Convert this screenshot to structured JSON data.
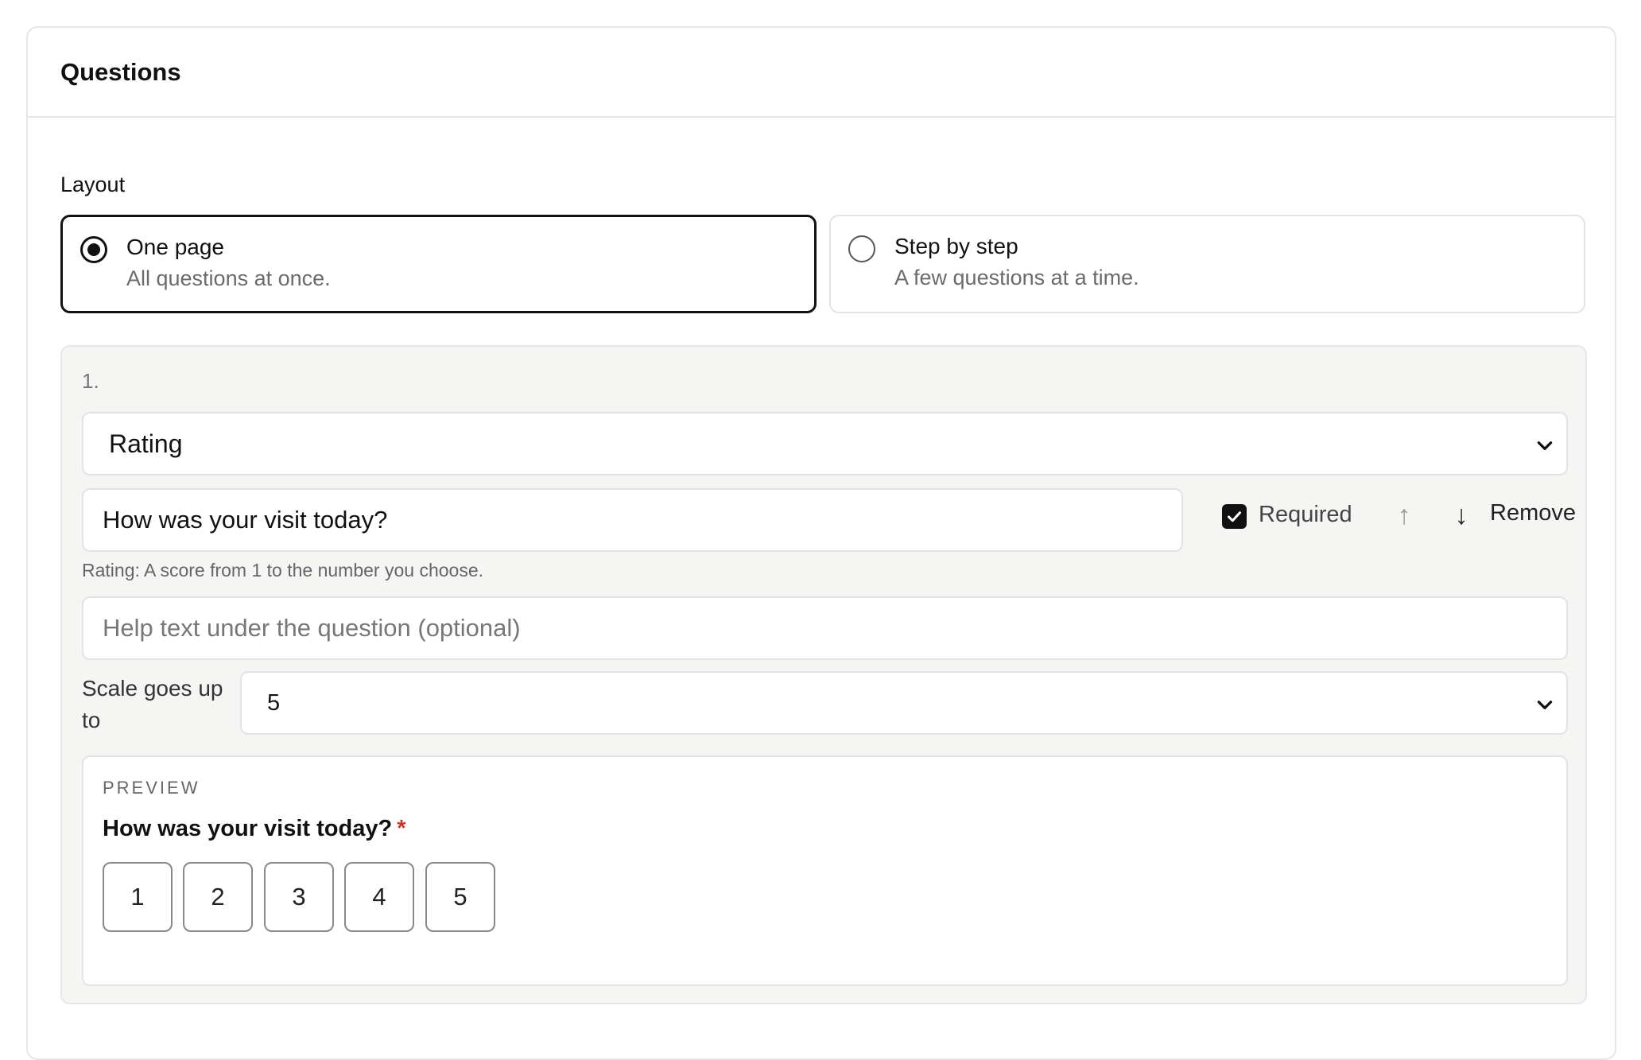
{
  "card": {
    "title": "Questions"
  },
  "layout": {
    "label": "Layout",
    "options": [
      {
        "title": "One page",
        "description": "All questions at once.",
        "selected": true
      },
      {
        "title": "Step by step",
        "description": "A few questions at a time.",
        "selected": false
      }
    ]
  },
  "question": {
    "number": "1.",
    "type_value": "Rating",
    "question_text": "How was your visit today?",
    "required_label": "Required",
    "required_checked": true,
    "move_up_icon": "↑",
    "move_down_icon": "↓",
    "remove_label": "Remove",
    "hint": "Rating: A score from 1 to the number you choose.",
    "help_placeholder": "Help text under the question (optional)",
    "scale_label": "Scale goes up to",
    "scale_value": "5"
  },
  "preview": {
    "label": "PREVIEW",
    "question": "How was your visit today?",
    "required_marker": "*",
    "ratings": [
      "1",
      "2",
      "3",
      "4",
      "5"
    ]
  }
}
